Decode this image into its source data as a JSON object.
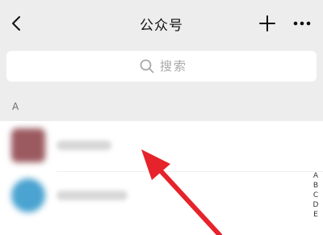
{
  "nav": {
    "title": "公众号",
    "back_icon": "chevron-left-icon",
    "add_icon": "plus-icon",
    "more_icon": "more-horizontal-icon"
  },
  "search": {
    "placeholder": "搜索",
    "icon": "search-icon"
  },
  "list": {
    "section_header": "A",
    "items": [
      {
        "avatar_color": "#9b5a60"
      },
      {
        "avatar_color": "#4aa3d0"
      }
    ]
  },
  "index_bar": {
    "letters": [
      "A",
      "B",
      "C",
      "D",
      "E"
    ]
  },
  "annotation": {
    "arrow_color": "#e6232b"
  }
}
